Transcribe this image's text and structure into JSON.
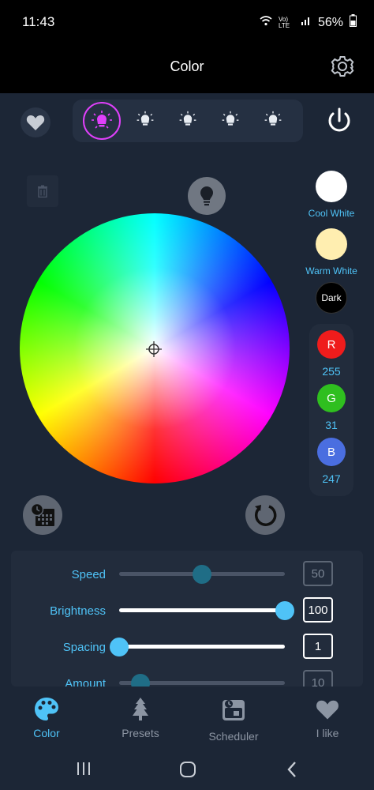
{
  "status_bar": {
    "time": "11:43",
    "battery": "56%",
    "signal_text": "Vo) LTE"
  },
  "header": {
    "title": "Color"
  },
  "colors": {
    "accent": "#4fc3f7",
    "active_bulb": "#e040fb",
    "background": "#1c2636",
    "panel": "#222c3c"
  },
  "bulbs": {
    "count": 5,
    "active_index": 0
  },
  "swatches": {
    "cool_white": "Cool White",
    "warm_white": "Warm White",
    "dark": "Dark"
  },
  "rgb": {
    "r_label": "R",
    "r_value": "255",
    "g_label": "G",
    "g_value": "31",
    "b_label": "B",
    "b_value": "247",
    "r_color": "#ef1c1c",
    "g_color": "#2fbf1f",
    "b_color": "#4a6ee0"
  },
  "sliders": [
    {
      "label": "Speed",
      "value": "50",
      "fraction": 0.5,
      "enabled": false
    },
    {
      "label": "Brightness",
      "value": "100",
      "fraction": 1.0,
      "enabled": true
    },
    {
      "label": "Spacing",
      "value": "1",
      "fraction": 0.0,
      "enabled": true
    },
    {
      "label": "Amount",
      "value": "10",
      "fraction": 0.13,
      "enabled": false
    }
  ],
  "nav": {
    "color": "Color",
    "presets": "Presets",
    "scheduler": "Scheduler",
    "ilike": "I like",
    "active": "color"
  }
}
